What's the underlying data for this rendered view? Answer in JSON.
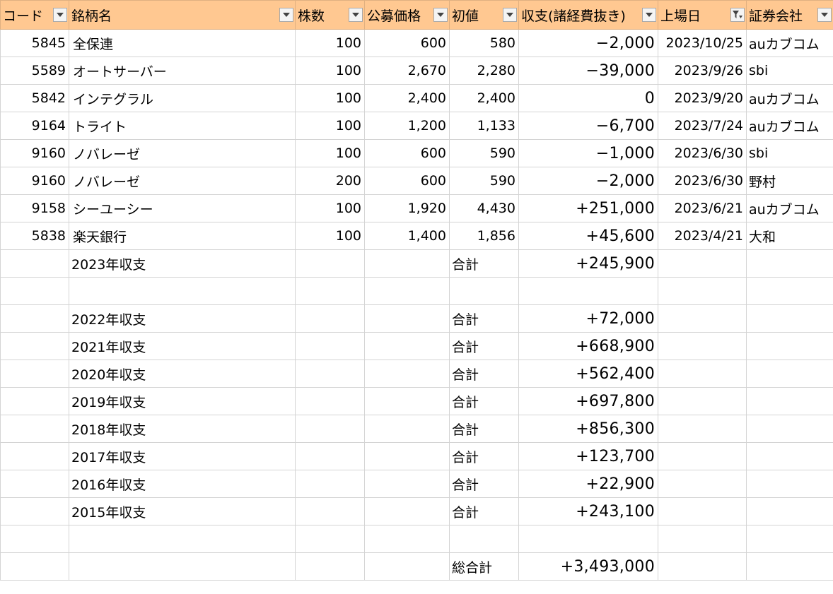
{
  "header": {
    "code": "コード",
    "name": "銘柄名",
    "shares": "株数",
    "offer_price": "公募価格",
    "initial_price": "初値",
    "pnl": "収支(諸経費抜き)",
    "listing_date": "上場日",
    "broker": "証券会社"
  },
  "rows": [
    {
      "code": "5845",
      "name": "全保連",
      "shares": "100",
      "offer": "600",
      "initial": "580",
      "pnl": "−2,000",
      "date": "2023/10/25",
      "broker": "auカブコム"
    },
    {
      "code": "5589",
      "name": "オートサーバー",
      "shares": "100",
      "offer": "2,670",
      "initial": "2,280",
      "pnl": "−39,000",
      "date": "2023/9/26",
      "broker": "sbi"
    },
    {
      "code": "5842",
      "name": "インテグラル",
      "shares": "100",
      "offer": "2,400",
      "initial": "2,400",
      "pnl": "0",
      "date": "2023/9/20",
      "broker": "auカブコム"
    },
    {
      "code": "9164",
      "name": "トライト",
      "shares": "100",
      "offer": "1,200",
      "initial": "1,133",
      "pnl": "−6,700",
      "date": "2023/7/24",
      "broker": "auカブコム"
    },
    {
      "code": "9160",
      "name": "ノバレーゼ",
      "shares": "100",
      "offer": "600",
      "initial": "590",
      "pnl": "−1,000",
      "date": "2023/6/30",
      "broker": "sbi"
    },
    {
      "code": "9160",
      "name": "ノバレーゼ",
      "shares": "200",
      "offer": "600",
      "initial": "590",
      "pnl": "−2,000",
      "date": "2023/6/30",
      "broker": "野村"
    },
    {
      "code": "9158",
      "name": "シーユーシー",
      "shares": "100",
      "offer": "1,920",
      "initial": "4,430",
      "pnl": "+251,000",
      "date": "2023/6/21",
      "broker": "auカブコム"
    },
    {
      "code": "5838",
      "name": "楽天銀行",
      "shares": "100",
      "offer": "1,400",
      "initial": "1,856",
      "pnl": "+45,600",
      "date": "2023/4/21",
      "broker": "大和"
    }
  ],
  "summary_2023": {
    "label": "2023年収支",
    "total_label": "合計",
    "value": "+245,900"
  },
  "yearly": [
    {
      "label": "2022年収支",
      "total_label": "合計",
      "value": "+72,000"
    },
    {
      "label": "2021年収支",
      "total_label": "合計",
      "value": "+668,900"
    },
    {
      "label": "2020年収支",
      "total_label": "合計",
      "value": "+562,400"
    },
    {
      "label": "2019年収支",
      "total_label": "合計",
      "value": "+697,800"
    },
    {
      "label": "2018年収支",
      "total_label": "合計",
      "value": "+856,300"
    },
    {
      "label": "2017年収支",
      "total_label": "合計",
      "value": "+123,700"
    },
    {
      "label": "2016年収支",
      "total_label": "合計",
      "value": "+22,900"
    },
    {
      "label": "2015年収支",
      "total_label": "合計",
      "value": "+243,100"
    }
  ],
  "grand_total": {
    "label": "総合計",
    "value": "+3,493,000"
  },
  "icons": {
    "dropdown": "chevron-down-icon",
    "active_filter": "filter-funnel-icon"
  },
  "colors": {
    "header_bg": "#ffc891",
    "grid": "#d4d4d4"
  }
}
